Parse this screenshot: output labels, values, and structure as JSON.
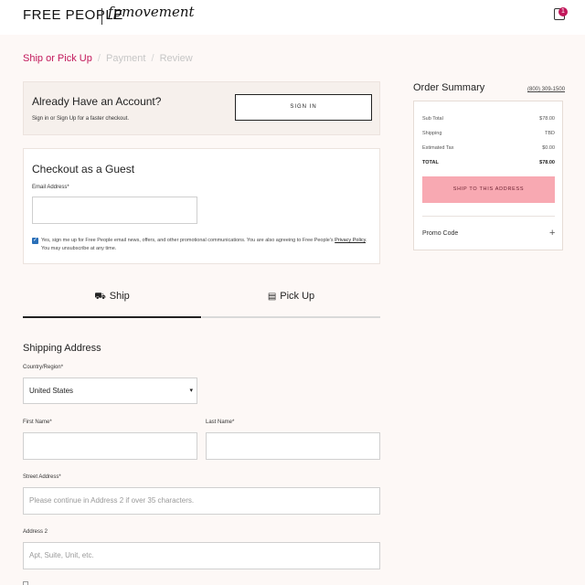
{
  "header": {
    "logo": "FREE PEOPLE",
    "logo_sub": "fpmovement",
    "bag_count": "1",
    "bag_icon": "shopping-bag-icon"
  },
  "breadcrumbs": {
    "ship": "Ship or Pick Up",
    "sep": "/",
    "payment": "Payment",
    "review": "Review"
  },
  "account": {
    "title": "Already Have an Account?",
    "subtitle": "Sign in or Sign Up for a faster checkout.",
    "signin_label": "SIGN IN"
  },
  "guest": {
    "title": "Checkout as a Guest",
    "email_label": "Email Address*",
    "email_value": "",
    "consent_prefix": "Yes, sign me up for Free People email news, offers, and other promotional communications. You are also agreeing to Free People's ",
    "consent_link": "Privacy Policy",
    "consent_suffix": ". You may unsubscribe at any time.",
    "consent_checked": true
  },
  "tabs": {
    "ship": "Ship",
    "pickup": "Pick Up",
    "ship_icon": "truck-icon",
    "pickup_icon": "store-icon"
  },
  "shipping": {
    "title": "Shipping Address",
    "country_label": "Country/Region*",
    "country_value": "United States",
    "first_name_label": "First Name*",
    "last_name_label": "Last Name*",
    "street_label": "Street Address*",
    "street_placeholder": "Please continue in Address 2 if over 35 characters.",
    "address2_label": "Address 2",
    "address2_placeholder": "Apt, Suite, Unit, etc."
  },
  "summary": {
    "title": "Order Summary",
    "phone": "(800) 309-1500",
    "rows": [
      {
        "label": "Sub Total",
        "value": "$78.00"
      },
      {
        "label": "Shipping",
        "value": "TBD"
      },
      {
        "label": "Estimated Tax",
        "value": "$0.00"
      },
      {
        "label": "TOTAL",
        "value": "$78.00"
      }
    ],
    "cta_label": "SHIP TO THIS ADDRESS",
    "promo_label": "Promo Code",
    "promo_icon": "plus-icon"
  },
  "colors": {
    "accent": "#c2185b",
    "cta": "#f8a9b2",
    "background": "#fdf8f6"
  }
}
